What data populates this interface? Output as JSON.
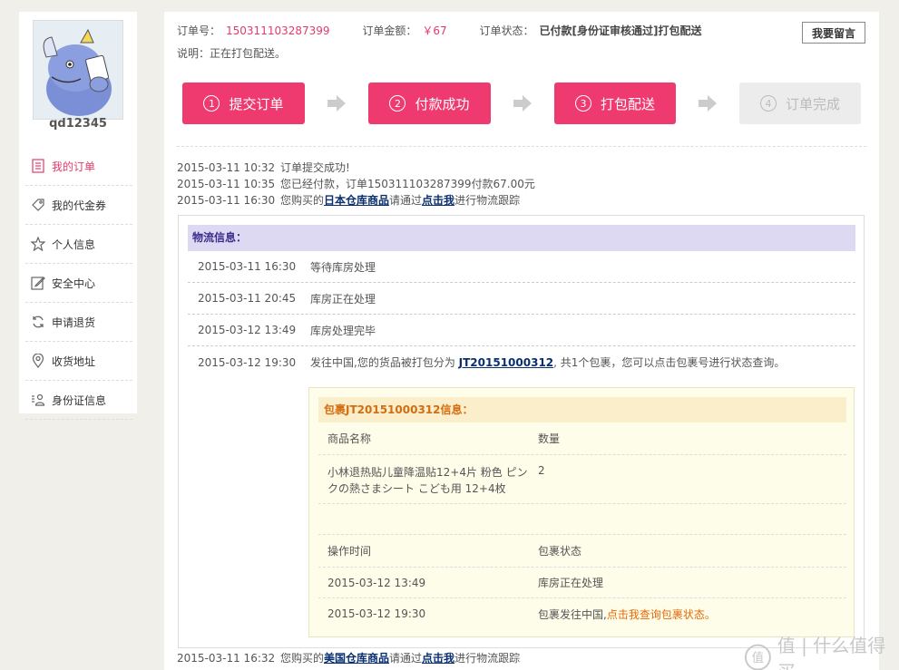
{
  "sidebar": {
    "username": "qd12345",
    "items": [
      {
        "label": "我的订单",
        "icon": "order-list-icon",
        "active": true
      },
      {
        "label": "我的代金券",
        "icon": "coupon-tag-icon",
        "active": false
      },
      {
        "label": "个人信息",
        "icon": "star-icon",
        "active": false
      },
      {
        "label": "安全中心",
        "icon": "edit-icon",
        "active": false
      },
      {
        "label": "申请退货",
        "icon": "refresh-icon",
        "active": false
      },
      {
        "label": "收货地址",
        "icon": "location-pin-icon",
        "active": false
      },
      {
        "label": "身份证信息",
        "icon": "id-card-icon",
        "active": false
      }
    ]
  },
  "order": {
    "no_label": "订单号：",
    "no_value": "150311103287399",
    "amount_label": "订单金额：",
    "amount_value": "￥67",
    "status_label": "订单状态：",
    "status_value": "已付款[身份证审核通过]打包配送",
    "note": "说明：正在打包配送。",
    "message_button": "我要留言"
  },
  "steps": [
    {
      "num": "1",
      "label": "提交订单",
      "done": true
    },
    {
      "num": "2",
      "label": "付款成功",
      "done": true
    },
    {
      "num": "3",
      "label": "打包配送",
      "done": true
    },
    {
      "num": "4",
      "label": "订单完成",
      "done": false
    }
  ],
  "log": [
    {
      "time": "2015-03-11 10:32",
      "text": "订单提交成功!"
    },
    {
      "time": "2015-03-11 10:35",
      "text": "您已经付款，订单150311103287399付款67.00元"
    },
    {
      "time": "2015-03-11 16:30",
      "pre": "您购买的",
      "bold": "日本仓库商品",
      "mid": "请通过",
      "link": "点击我",
      "post": "进行物流跟踪"
    }
  ],
  "logistics": {
    "title": "物流信息：",
    "rows": [
      {
        "time": "2015-03-11 16:30",
        "text": "等待库房处理"
      },
      {
        "time": "2015-03-11 20:45",
        "text": "库房正在处理"
      },
      {
        "time": "2015-03-12 13:49",
        "text": "库房处理完毕"
      },
      {
        "time": "2015-03-12 19:30",
        "pre": "发往中国,您的货品被打包分为 ",
        "link": "JT20151000312",
        "post": ", 共1个包裹，您可以点击包裹号进行状态查询。"
      }
    ]
  },
  "package": {
    "title": "包裹JT20151000312信息：",
    "col_name": "商品名称",
    "col_qty": "数量",
    "item_name": "小林退热贴儿童降温贴12+4片 粉色 ピンクの熱さまシート こども用 12+4枚",
    "item_qty": "2",
    "col_time": "操作时间",
    "col_status": "包裹状态",
    "status_rows": [
      {
        "time": "2015-03-12 13:49",
        "status": "库房正在处理"
      },
      {
        "time": "2015-03-12 19:30",
        "status_pre": "包裹发往中国,",
        "status_link": "点击我查询包裹状态。"
      }
    ]
  },
  "log_bottom": {
    "time": "2015-03-11 16:32",
    "pre": "您购买的",
    "bold": "美国仓库商品",
    "mid": "请通过",
    "link": "点击我",
    "post": "进行物流跟踪"
  },
  "watermark": "值 | 什么值得买"
}
